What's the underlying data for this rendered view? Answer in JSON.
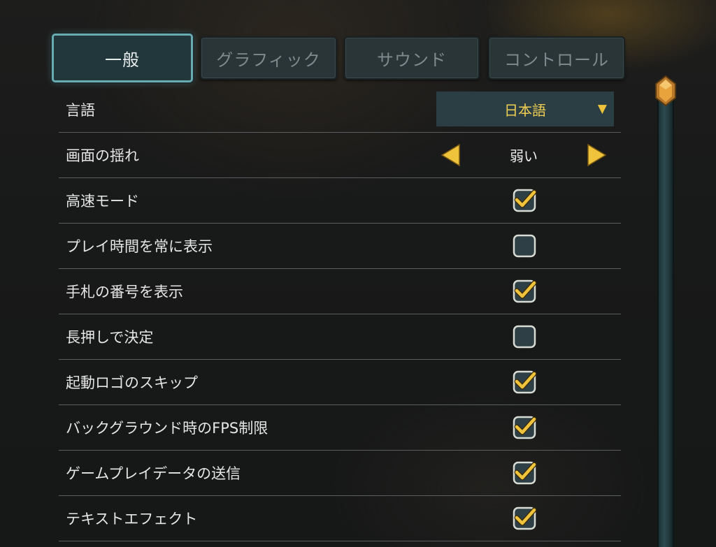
{
  "tabs": [
    {
      "label": "一般",
      "active": true
    },
    {
      "label": "グラフィック",
      "active": false
    },
    {
      "label": "サウンド",
      "active": false
    },
    {
      "label": "コントロール",
      "active": false
    }
  ],
  "settings": {
    "language": {
      "label": "言語",
      "value": "日本語",
      "arrow": "▼"
    },
    "screen_shake": {
      "label": "画面の揺れ",
      "value": "弱い"
    },
    "fast_mode": {
      "label": "高速モード",
      "checked": true
    },
    "show_playtime": {
      "label": "プレイ時間を常に表示",
      "checked": false
    },
    "show_hand_numbers": {
      "label": "手札の番号を表示",
      "checked": true
    },
    "long_press_confirm": {
      "label": "長押しで決定",
      "checked": false
    },
    "skip_logo": {
      "label": "起動ロゴのスキップ",
      "checked": true
    },
    "background_fps_limit": {
      "label": "バックグラウンド時のFPS制限",
      "checked": true
    },
    "send_gameplay_data": {
      "label": "ゲームプレイデータの送信",
      "checked": true
    },
    "text_effects": {
      "label": "テキストエフェクト",
      "checked": true
    }
  },
  "colors": {
    "accent_gold": "#f0c33c",
    "tab_active_border": "#6aaab1",
    "checkbox_fill": "#2e3f45"
  }
}
